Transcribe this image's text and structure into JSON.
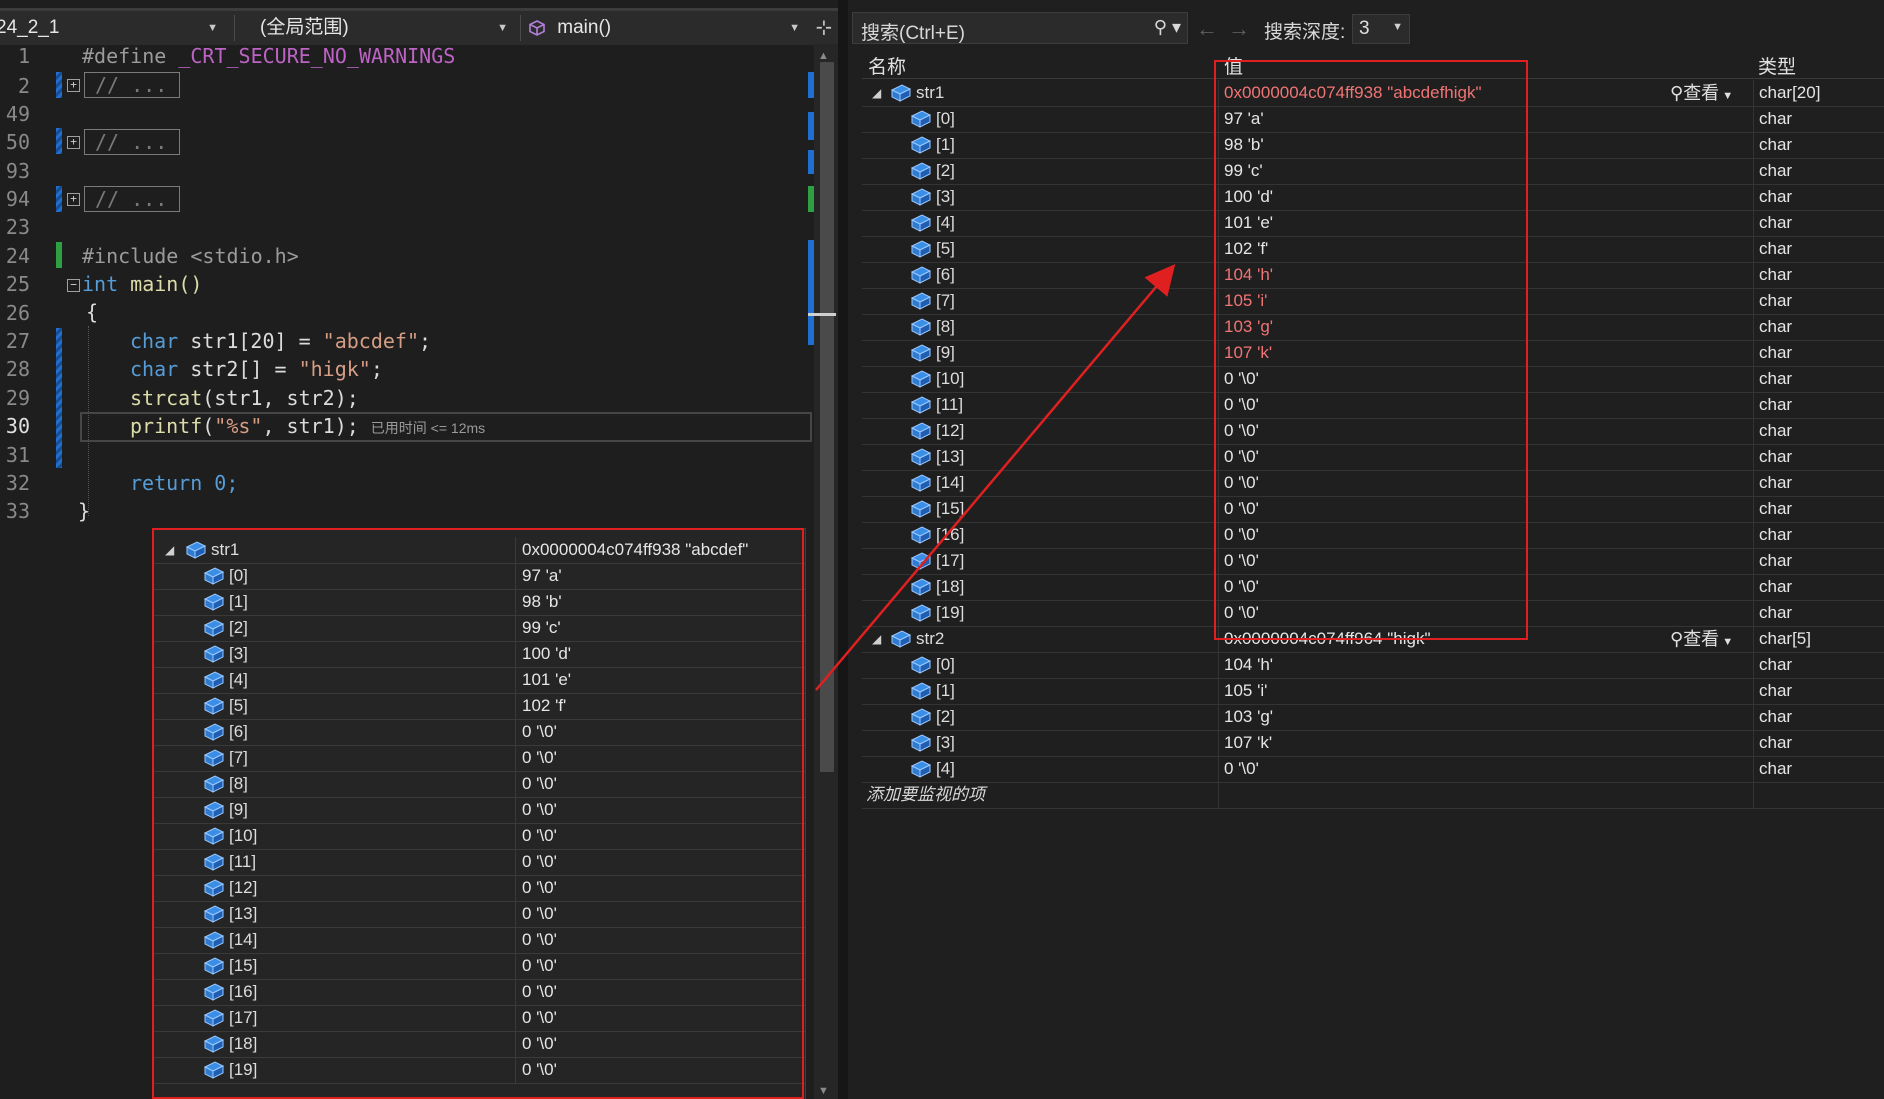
{
  "editor": {
    "nav": {
      "project": "24_2_1",
      "scope": "(全局范围)",
      "member": "main()"
    },
    "lines": [
      {
        "num": "1"
      },
      {
        "num": "2"
      },
      {
        "num": "49"
      },
      {
        "num": "50"
      },
      {
        "num": "93"
      },
      {
        "num": "94"
      },
      {
        "num": "23"
      },
      {
        "num": "24"
      },
      {
        "num": "25"
      },
      {
        "num": "26"
      },
      {
        "num": "27"
      },
      {
        "num": "28"
      },
      {
        "num": "29"
      },
      {
        "num": "30"
      },
      {
        "num": "31"
      },
      {
        "num": "32"
      },
      {
        "num": "33"
      }
    ],
    "collapsed_text": "// ...",
    "code": {
      "define_kw": "#define",
      "define_name": "_CRT_SECURE_NO_WARNINGS",
      "include_kw": "#include",
      "include_hdr": "<stdio.h>",
      "int_kw": "int",
      "main_sig": "main()",
      "open_brace": "{",
      "char_kw_1": "char",
      "decl1_name": "str1[20] = ",
      "decl1_str": "\"abcdef\"",
      "decl1_end": ";",
      "char_kw_2": "char",
      "decl2_name": "str2[] = ",
      "decl2_str": "\"higk\"",
      "decl2_end": ";",
      "strcat_fn": "strcat",
      "strcat_args": "(str1, str2);",
      "printf_fn": "printf",
      "printf_open": "(",
      "printf_fmt": "\"%s\"",
      "printf_rest": ", str1);",
      "perf_tip": "已用时间 <= 12ms",
      "return_stmt": "return 0;",
      "close_brace": "}"
    },
    "datatip": {
      "var_name": "str1",
      "var_value": "0x0000004c074ff938 \"abcdef\"",
      "elements": [
        {
          "idx": "[0]",
          "val": "97 'a'"
        },
        {
          "idx": "[1]",
          "val": "98 'b'"
        },
        {
          "idx": "[2]",
          "val": "99 'c'"
        },
        {
          "idx": "[3]",
          "val": "100 'd'"
        },
        {
          "idx": "[4]",
          "val": "101 'e'"
        },
        {
          "idx": "[5]",
          "val": "102 'f'"
        },
        {
          "idx": "[6]",
          "val": "0 '\\0'"
        },
        {
          "idx": "[7]",
          "val": "0 '\\0'"
        },
        {
          "idx": "[8]",
          "val": "0 '\\0'"
        },
        {
          "idx": "[9]",
          "val": "0 '\\0'"
        },
        {
          "idx": "[10]",
          "val": "0 '\\0'"
        },
        {
          "idx": "[11]",
          "val": "0 '\\0'"
        },
        {
          "idx": "[12]",
          "val": "0 '\\0'"
        },
        {
          "idx": "[13]",
          "val": "0 '\\0'"
        },
        {
          "idx": "[14]",
          "val": "0 '\\0'"
        },
        {
          "idx": "[15]",
          "val": "0 '\\0'"
        },
        {
          "idx": "[16]",
          "val": "0 '\\0'"
        },
        {
          "idx": "[17]",
          "val": "0 '\\0'"
        },
        {
          "idx": "[18]",
          "val": "0 '\\0'"
        },
        {
          "idx": "[19]",
          "val": "0 '\\0'"
        }
      ]
    }
  },
  "watch": {
    "search_placeholder": "搜索(Ctrl+E)",
    "search_depth_label": "搜索深度:",
    "search_depth_value": "3",
    "columns": {
      "name": "名称",
      "value": "值",
      "type": "类型"
    },
    "inspect_label": "查看",
    "str1": {
      "name": "str1",
      "value": "0x0000004c074ff938 \"abcdefhigk\"",
      "type": "char[20]",
      "elements": [
        {
          "idx": "[0]",
          "val": "97 'a'",
          "type": "char",
          "changed": false
        },
        {
          "idx": "[1]",
          "val": "98 'b'",
          "type": "char",
          "changed": false
        },
        {
          "idx": "[2]",
          "val": "99 'c'",
          "type": "char",
          "changed": false
        },
        {
          "idx": "[3]",
          "val": "100 'd'",
          "type": "char",
          "changed": false
        },
        {
          "idx": "[4]",
          "val": "101 'e'",
          "type": "char",
          "changed": false
        },
        {
          "idx": "[5]",
          "val": "102 'f'",
          "type": "char",
          "changed": false
        },
        {
          "idx": "[6]",
          "val": "104 'h'",
          "type": "char",
          "changed": true
        },
        {
          "idx": "[7]",
          "val": "105 'i'",
          "type": "char",
          "changed": true
        },
        {
          "idx": "[8]",
          "val": "103 'g'",
          "type": "char",
          "changed": true
        },
        {
          "idx": "[9]",
          "val": "107 'k'",
          "type": "char",
          "changed": true
        },
        {
          "idx": "[10]",
          "val": "0 '\\0'",
          "type": "char",
          "changed": false
        },
        {
          "idx": "[11]",
          "val": "0 '\\0'",
          "type": "char",
          "changed": false
        },
        {
          "idx": "[12]",
          "val": "0 '\\0'",
          "type": "char",
          "changed": false
        },
        {
          "idx": "[13]",
          "val": "0 '\\0'",
          "type": "char",
          "changed": false
        },
        {
          "idx": "[14]",
          "val": "0 '\\0'",
          "type": "char",
          "changed": false
        },
        {
          "idx": "[15]",
          "val": "0 '\\0'",
          "type": "char",
          "changed": false
        },
        {
          "idx": "[16]",
          "val": "0 '\\0'",
          "type": "char",
          "changed": false
        },
        {
          "idx": "[17]",
          "val": "0 '\\0'",
          "type": "char",
          "changed": false
        },
        {
          "idx": "[18]",
          "val": "0 '\\0'",
          "type": "char",
          "changed": false
        },
        {
          "idx": "[19]",
          "val": "0 '\\0'",
          "type": "char",
          "changed": false
        }
      ]
    },
    "str2": {
      "name": "str2",
      "value": "0x0000004c074ff964 \"higk\"",
      "type": "char[5]",
      "elements": [
        {
          "idx": "[0]",
          "val": "104 'h'",
          "type": "char"
        },
        {
          "idx": "[1]",
          "val": "105 'i'",
          "type": "char"
        },
        {
          "idx": "[2]",
          "val": "103 'g'",
          "type": "char"
        },
        {
          "idx": "[3]",
          "val": "107 'k'",
          "type": "char"
        },
        {
          "idx": "[4]",
          "val": "0 '\\0'",
          "type": "char"
        }
      ]
    },
    "add_watch": "添加要监视的项"
  },
  "colors": {
    "annotation": "#e02020",
    "changed_value": "#f07474",
    "keyword": "#569cd6",
    "string": "#d69d85"
  }
}
